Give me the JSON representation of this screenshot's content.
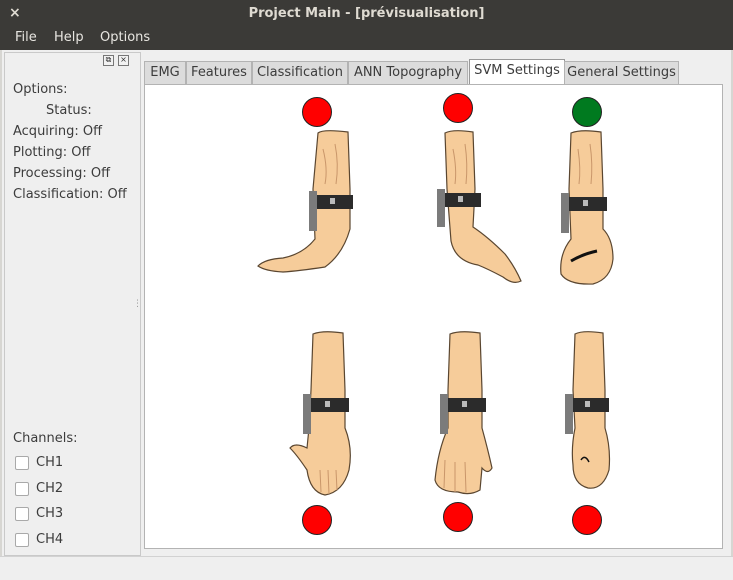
{
  "window": {
    "title": "Project Main - [prévisualisation]",
    "close_glyph": "×"
  },
  "menu": [
    {
      "label": "File"
    },
    {
      "label": "Help"
    },
    {
      "label": "Options"
    }
  ],
  "sidebar": {
    "options_heading": "Options:",
    "status_heading": "Status:",
    "status_items": [
      {
        "label": "Acquiring: Off"
      },
      {
        "label": "Plotting: Off"
      },
      {
        "label": "Processing: Off"
      },
      {
        "label": "Classification: Off"
      }
    ],
    "channels_heading": "Channels:",
    "channels": [
      {
        "label": "CH1",
        "checked": false
      },
      {
        "label": "CH2",
        "checked": false
      },
      {
        "label": "CH3",
        "checked": false
      },
      {
        "label": "CH4",
        "checked": false
      }
    ],
    "dock_float_glyph": "⧉",
    "dock_close_glyph": "×"
  },
  "tabs": [
    {
      "label": "EMG",
      "active": false
    },
    {
      "label": "Features",
      "active": false
    },
    {
      "label": "Classification",
      "active": false
    },
    {
      "label": "ANN Topography",
      "active": false
    },
    {
      "label": "SVM Settings",
      "active": true
    },
    {
      "label": "General Settings",
      "active": false
    }
  ],
  "gestures": {
    "colors": {
      "inactive": "#ff0000",
      "active": "#007a1f"
    },
    "items": [
      {
        "icon": "wrist-flexion-icon",
        "state": "inactive"
      },
      {
        "icon": "wrist-extension-icon",
        "state": "inactive"
      },
      {
        "icon": "fist-icon",
        "state": "active"
      },
      {
        "icon": "open-hand-icon",
        "state": "inactive"
      },
      {
        "icon": "relaxed-hand-icon",
        "state": "inactive"
      },
      {
        "icon": "pointing-hand-icon",
        "state": "inactive"
      }
    ]
  }
}
